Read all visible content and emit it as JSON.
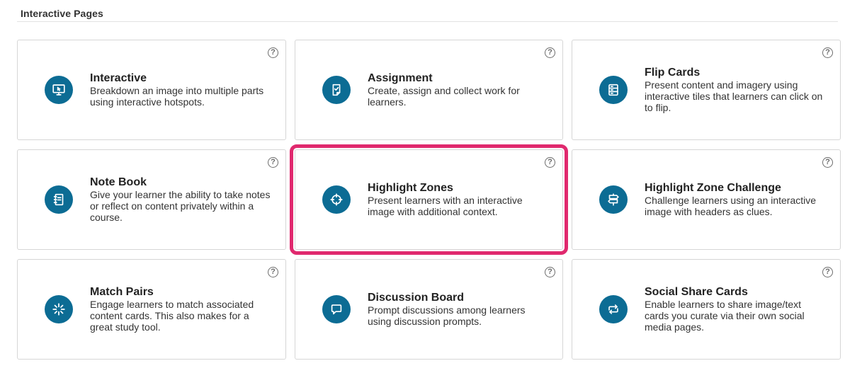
{
  "section": {
    "title": "Interactive Pages"
  },
  "help_glyph": "?",
  "accent_color": "#0c6c94",
  "selected_outline_color": "#e0296e",
  "cards": [
    {
      "title": "Interactive",
      "description": "Breakdown an image into multiple parts using interactive hotspots.",
      "icon": "monitor-cursor-icon"
    },
    {
      "title": "Assignment",
      "description": "Create, assign and collect work for learners.",
      "icon": "checklist-clipboard-icon"
    },
    {
      "title": "Flip Cards",
      "description": "Present content and imagery using interactive tiles that learners can click on to flip.",
      "icon": "stacked-cards-icon"
    },
    {
      "title": "Note Book",
      "description": "Give your learner the ability to take notes or reflect on content privately within a course.",
      "icon": "notebook-icon"
    },
    {
      "title": "Highlight Zones",
      "description": "Present learners with an interactive image with additional context.",
      "icon": "crosshair-icon",
      "selected": true
    },
    {
      "title": "Highlight Zone Challenge",
      "description": "Challenge learners using an interactive image with headers as clues.",
      "icon": "signpost-icon"
    },
    {
      "title": "Match Pairs",
      "description": "Engage learners to match associated content cards. This also makes for a great study tool.",
      "icon": "burst-icon"
    },
    {
      "title": "Discussion Board",
      "description": "Prompt discussions among learners using discussion prompts.",
      "icon": "speech-bubble-icon"
    },
    {
      "title": "Social Share Cards",
      "description": "Enable learners to share image/text cards you curate via their own social media pages.",
      "icon": "share-arrows-icon"
    }
  ]
}
